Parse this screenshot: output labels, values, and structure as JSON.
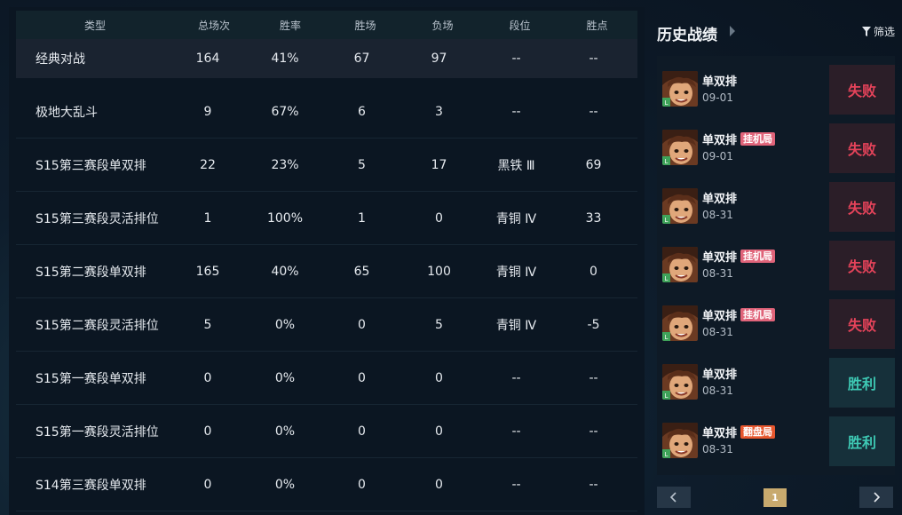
{
  "stats": {
    "headers": {
      "type": "类型",
      "total": "总场次",
      "rate": "胜率",
      "wins": "胜场",
      "losses": "负场",
      "rank": "段位",
      "lp": "胜点"
    },
    "rows": [
      {
        "type": "经典对战",
        "total": "164",
        "rate": "41%",
        "wins": "67",
        "losses": "97",
        "rank": "--",
        "lp": "--"
      },
      {
        "type": "极地大乱斗",
        "total": "9",
        "rate": "67%",
        "wins": "6",
        "losses": "3",
        "rank": "--",
        "lp": "--"
      },
      {
        "type": "S15第三赛段单双排",
        "total": "22",
        "rate": "23%",
        "wins": "5",
        "losses": "17",
        "rank": "黑铁 Ⅲ",
        "lp": "69"
      },
      {
        "type": "S15第三赛段灵活排位",
        "total": "1",
        "rate": "100%",
        "wins": "1",
        "losses": "0",
        "rank": "青铜 Ⅳ",
        "lp": "33"
      },
      {
        "type": "S15第二赛段单双排",
        "total": "165",
        "rate": "40%",
        "wins": "65",
        "losses": "100",
        "rank": "青铜 Ⅳ",
        "lp": "0"
      },
      {
        "type": "S15第二赛段灵活排位",
        "total": "5",
        "rate": "0%",
        "wins": "0",
        "losses": "5",
        "rank": "青铜 Ⅳ",
        "lp": "-5"
      },
      {
        "type": "S15第一赛段单双排",
        "total": "0",
        "rate": "0%",
        "wins": "0",
        "losses": "0",
        "rank": "--",
        "lp": "--"
      },
      {
        "type": "S15第一赛段灵活排位",
        "total": "0",
        "rate": "0%",
        "wins": "0",
        "losses": "0",
        "rank": "--",
        "lp": "--"
      },
      {
        "type": "S14第三赛段单双排",
        "total": "0",
        "rate": "0%",
        "wins": "0",
        "losses": "0",
        "rank": "--",
        "lp": "--"
      }
    ]
  },
  "history": {
    "title": "历史战绩",
    "filter_label": "筛选",
    "matches": [
      {
        "mode": "单双排",
        "tag": "",
        "tag_kind": "",
        "date": "09-01",
        "result": "失败",
        "outcome": "loss"
      },
      {
        "mode": "单双排",
        "tag": "挂机局",
        "tag_kind": "afk",
        "date": "09-01",
        "result": "失败",
        "outcome": "loss"
      },
      {
        "mode": "单双排",
        "tag": "",
        "tag_kind": "",
        "date": "08-31",
        "result": "失败",
        "outcome": "loss"
      },
      {
        "mode": "单双排",
        "tag": "挂机局",
        "tag_kind": "afk",
        "date": "08-31",
        "result": "失败",
        "outcome": "loss"
      },
      {
        "mode": "单双排",
        "tag": "挂机局",
        "tag_kind": "afk",
        "date": "08-31",
        "result": "失败",
        "outcome": "loss"
      },
      {
        "mode": "单双排",
        "tag": "",
        "tag_kind": "",
        "date": "08-31",
        "result": "胜利",
        "outcome": "win"
      },
      {
        "mode": "单双排",
        "tag": "翻盘局",
        "tag_kind": "comeback",
        "date": "08-31",
        "result": "胜利",
        "outcome": "win"
      }
    ],
    "page": "1"
  },
  "colors": {
    "loss": "#e5435a",
    "win": "#3ec9b4",
    "afk_tag": "#e0647a",
    "comeback_tag": "#e7572e",
    "page_active": "#c8aa6e"
  }
}
